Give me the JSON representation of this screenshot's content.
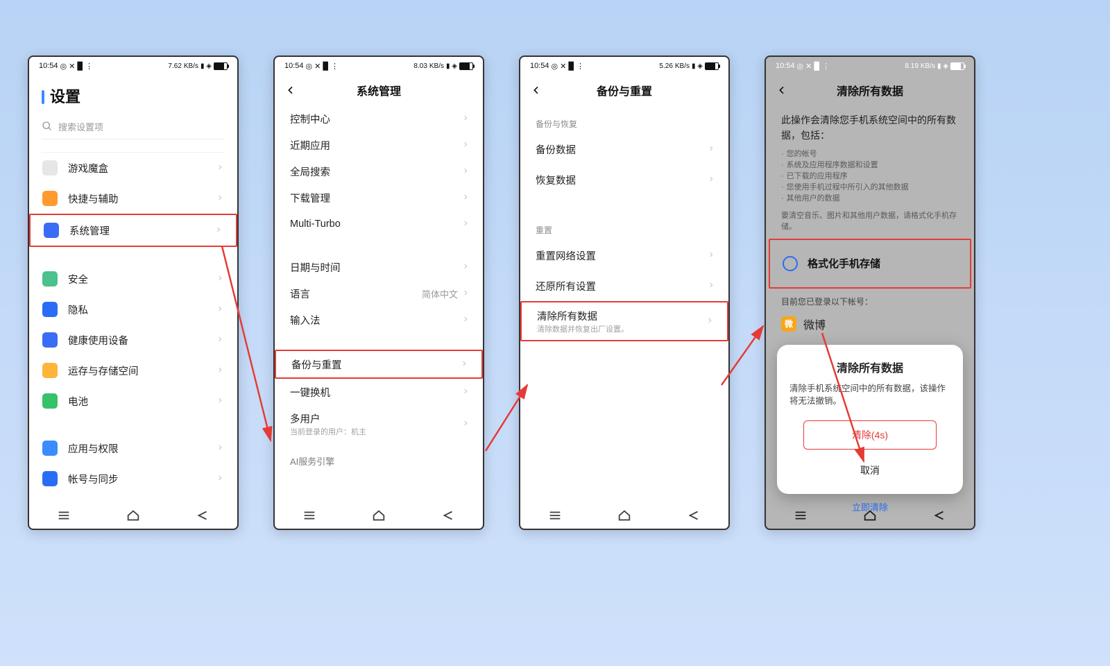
{
  "status": {
    "time": "10:54",
    "r1": "7.62",
    "r2": "KB/s",
    "r3": "8.03",
    "r4": "KB/s",
    "r5": "5.26",
    "r6": "KB/s",
    "r7": "8.19",
    "r8": "KB/s"
  },
  "p1": {
    "title": "设置",
    "searchPlaceholder": "搜索设置项",
    "rows": [
      {
        "id": "game",
        "label": "游戏魔盒",
        "iconColor": "#e6e6e6"
      },
      {
        "id": "shortcut",
        "label": "快捷与辅助",
        "iconColor": "#ff9a2e"
      },
      {
        "id": "system",
        "label": "系统管理",
        "iconColor": "#3a6df5",
        "hl": true
      },
      {
        "id": "security",
        "label": "安全",
        "iconColor": "#4bc18e"
      },
      {
        "id": "privacy",
        "label": "隐私",
        "iconColor": "#2a6df5"
      },
      {
        "id": "health",
        "label": "健康使用设备",
        "iconColor": "#3a6df5"
      },
      {
        "id": "storage",
        "label": "运存与存储空间",
        "iconColor": "#ffb43a"
      },
      {
        "id": "battery",
        "label": "电池",
        "iconColor": "#35c26a"
      },
      {
        "id": "apps",
        "label": "应用与权限",
        "iconColor": "#3a8cff"
      },
      {
        "id": "account",
        "label": "帐号与同步",
        "iconColor": "#2a6df5"
      }
    ]
  },
  "p2": {
    "title": "系统管理",
    "rows1": [
      {
        "id": "control",
        "label": "控制中心"
      },
      {
        "id": "recent",
        "label": "近期应用"
      },
      {
        "id": "globalsearch",
        "label": "全局搜索"
      },
      {
        "id": "download",
        "label": "下载管理"
      },
      {
        "id": "multiturbo",
        "label": "Multi-Turbo"
      }
    ],
    "rows2": [
      {
        "id": "datetime",
        "label": "日期与时间"
      },
      {
        "id": "language",
        "label": "语言",
        "value": "简体中文"
      },
      {
        "id": "input",
        "label": "输入法"
      }
    ],
    "rows3": [
      {
        "id": "backup",
        "label": "备份与重置",
        "hl": true
      },
      {
        "id": "clone",
        "label": "一键换机"
      },
      {
        "id": "multiuser",
        "label": "多用户",
        "sub": "当前登录的用户：机主"
      }
    ],
    "cut": "AI服务引擎"
  },
  "p3": {
    "title": "备份与重置",
    "sec1": "备份与恢复",
    "rows1": [
      {
        "id": "backupdata",
        "label": "备份数据"
      },
      {
        "id": "restoredata",
        "label": "恢复数据"
      }
    ],
    "sec2": "重置",
    "rows2": [
      {
        "id": "resetnet",
        "label": "重置网络设置"
      },
      {
        "id": "restoreall",
        "label": "还原所有设置"
      },
      {
        "id": "clearall",
        "label": "清除所有数据",
        "sub": "清除数据并恢复出厂设置。",
        "hl": true
      }
    ]
  },
  "p4": {
    "title": "清除所有数据",
    "intro": "此操作会清除您手机系统空间中的所有数据，包括：",
    "bullets": [
      "您的帐号",
      "系统及应用程序数据和设置",
      "已下载的应用程序",
      "您使用手机过程中所引入的其他数据",
      "其他用户的数据"
    ],
    "note": "要清空音乐、图片和其他用户数据，请格式化手机存储。",
    "formatLabel": "格式化手机存储",
    "acctHeader": "目前您已登录以下帐号：",
    "acctName": "微博",
    "modalTitle": "清除所有数据",
    "modalBody": "清除手机系统空间中的所有数据，该操作将无法撤销。",
    "clearBtn": "清除(4s)",
    "cancelBtn": "取消",
    "underLink": "立即清除"
  }
}
